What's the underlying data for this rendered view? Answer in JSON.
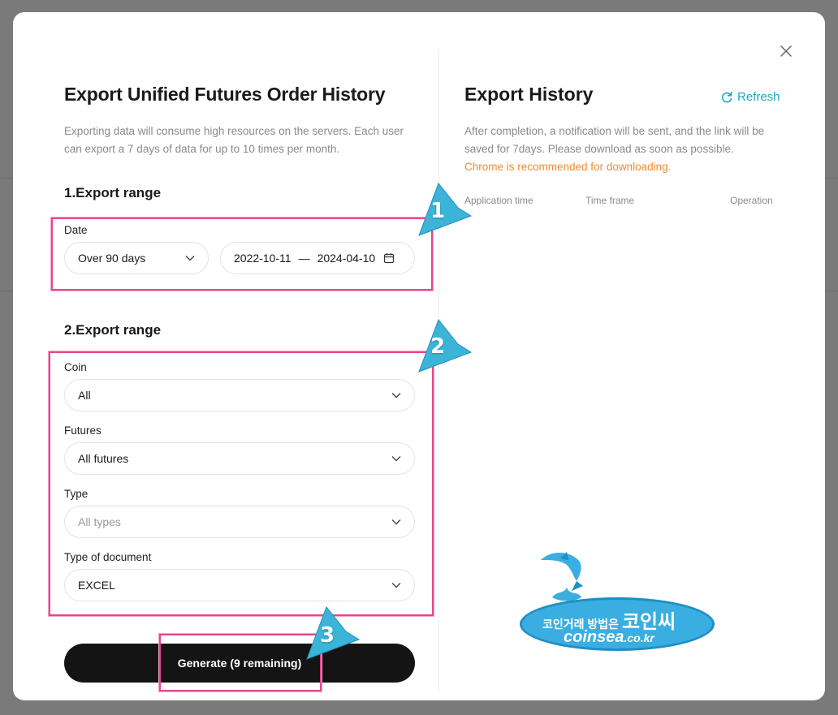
{
  "left": {
    "title": "Export Unified Futures Order History",
    "description": "Exporting data will consume high resources on the servers. Each user can export a 7 days of data for up to 10 times per month.",
    "section1": {
      "title": "1.Export range",
      "date_label": "Date",
      "date_select_value": "Over 90 days",
      "date_start": "2022-10-11",
      "date_separator": "—",
      "date_end": "2024-04-10"
    },
    "section2": {
      "title": "2.Export range",
      "coin_label": "Coin",
      "coin_value": "All",
      "futures_label": "Futures",
      "futures_value": "All futures",
      "type_label": "Type",
      "type_placeholder": "All types",
      "doc_label": "Type of document",
      "doc_value": "EXCEL"
    },
    "generate_label": "Generate (9 remaining)"
  },
  "right": {
    "title": "Export History",
    "refresh_label": "Refresh",
    "desc_main": "After completion, a notification will be sent, and the link will be saved for 7days. Please download as soon as possible.",
    "desc_warn": "Chrome is recommended for downloading.",
    "columns": [
      "Application time",
      "Time frame",
      "Operation"
    ]
  },
  "annotations": {
    "badge1": "1",
    "badge2": "2",
    "badge3": "3"
  },
  "watermark": {
    "korean_small": "코인거래 방법은",
    "korean_big": "코인씨",
    "english": "coinsea",
    "english_suffix": ".co.kr"
  },
  "colors": {
    "accent": "#1aa8c8",
    "warning": "#f28a2e",
    "highlight": "#e8458b",
    "button": "#141414"
  }
}
